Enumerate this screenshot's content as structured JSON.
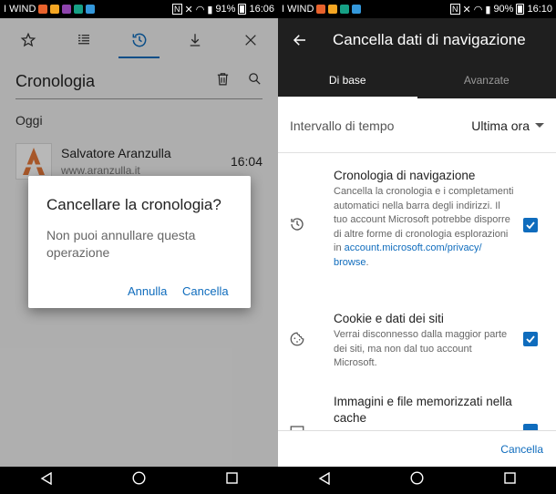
{
  "left": {
    "statusbar": {
      "carrier": "I WIND",
      "battery": "91%",
      "time": "16:06"
    },
    "toolbar": {
      "icons": [
        "star-icon",
        "reading-list-icon",
        "history-icon",
        "download-icon",
        "close-icon"
      ],
      "active": "history-icon"
    },
    "title": "Cronologia",
    "section": "Oggi",
    "history_item": {
      "title": "Salvatore Aranzulla",
      "url": "www.aranzulla.it",
      "time": "16:04"
    },
    "dialog": {
      "title": "Cancellare la cronologia?",
      "message": "Non puoi annullare questa operazione",
      "cancel_label": "Annulla",
      "confirm_label": "Cancella"
    }
  },
  "right": {
    "statusbar": {
      "carrier": "I WIND",
      "battery": "90%",
      "time": "16:10"
    },
    "title": "Cancella dati di navigazione",
    "tabs": [
      {
        "label": "Di base",
        "active": true
      },
      {
        "label": "Avanzate",
        "active": false
      }
    ],
    "time_range": {
      "label": "Intervallo di tempo",
      "value": "Ultima ora"
    },
    "options": [
      {
        "title": "Cronologia di navigazione",
        "description": "Cancella la cronologia e i completamenti automatici nella barra degli indirizzi. Il tuo account Microsoft potrebbe disporre di altre forme di cronologia esplorazioni in",
        "link": "account.microsoft.com/privacy/",
        "link2": "browse",
        "suffix": ".",
        "icon": "history-icon",
        "checked": true
      },
      {
        "title": "Cookie e dati dei siti",
        "description": "Verrai disconnesso dalla maggior parte dei siti, ma non dal tuo account Microsoft.",
        "icon": "cookie-icon",
        "checked": true
      },
      {
        "title": "Immagini e file memorizzati nella cache",
        "icon": "image-icon",
        "checked": true
      }
    ],
    "footer_button": "Cancella"
  },
  "colors": {
    "accent": "#0f6cbd",
    "appbar": "#1f1f1f",
    "panel": "#f2f2f2"
  }
}
